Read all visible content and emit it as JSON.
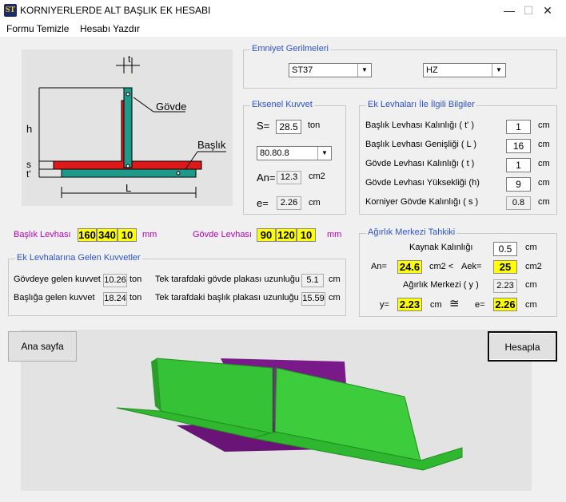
{
  "window": {
    "title": "KORNIYERLERDE ALT BAŞLIK EK HESABI",
    "icon_text": "ST",
    "min": "—",
    "max": "☐",
    "close": "✕"
  },
  "menu": {
    "item1": "Formu Temizle",
    "item2": "Hesabı Yazdır"
  },
  "sketch": {
    "t": "t",
    "h": "h",
    "s": "s",
    "t_prime": "t'",
    "L": "L",
    "govde": "Gövde",
    "baslik": "Başlık"
  },
  "emniyet": {
    "title": "Emniyet Gerilmeleri",
    "material": "ST37",
    "load_case": "HZ"
  },
  "eksenel": {
    "title": "Eksenel Kuvvet",
    "s_label": "S=",
    "s_value": "28.5",
    "s_unit": "ton",
    "section": "80.80.8",
    "an_label": "An=",
    "an_value": "12.3",
    "an_unit": "cm2",
    "e_label": "e=",
    "e_value": "2.26",
    "e_unit": "cm"
  },
  "ek": {
    "title": "Ek Levhaları İle İlgili Bilgiler",
    "rows": [
      {
        "label": "Başlık Levhası Kalınlığı ( t' )",
        "value": "1",
        "unit": "cm"
      },
      {
        "label": "Başlık Levhası Genişliği ( L )",
        "value": "16",
        "unit": "cm"
      },
      {
        "label": "Gövde Levhası Kalınlığı ( t )",
        "value": "1",
        "unit": "cm"
      },
      {
        "label": "Gövde Levhası Yüksekliği (h)",
        "value": "9",
        "unit": "cm"
      },
      {
        "label": "Korniyer Gövde Kalınlığı ( s )",
        "value": "0.8",
        "unit": "cm"
      }
    ]
  },
  "baslik_levhasi": {
    "label": "Başlık Levhası",
    "v1": "160",
    "v2": "340",
    "v3": "10",
    "unit": "mm"
  },
  "govde_levhasi": {
    "label": "Gövde Levhası",
    "v1": "90",
    "v2": "120",
    "v3": "10",
    "unit": "mm"
  },
  "kuvvet": {
    "title": "Ek Levhalarına Gelen Kuvvetler",
    "govde_label": "Gövdeye gelen kuvvet",
    "govde_value": "10.26",
    "govde_unit": "ton",
    "baslik_label": "Başlığa gelen kuvvet",
    "baslik_value": "18.24",
    "baslik_unit": "ton",
    "tek_govde_label": "Tek tarafdaki gövde plakası uzunluğu",
    "tek_govde_value": "5.1",
    "tek_govde_unit": "cm",
    "tek_baslik_label": "Tek tarafdaki başlık plakası uzunluğu",
    "tek_baslik_value": "15.59",
    "tek_baslik_unit": "cm"
  },
  "agirlik": {
    "title": "Ağırlık Merkezi Tahkiki",
    "kaynak_label": "Kaynak Kalınlığı",
    "kaynak_value": "0.5",
    "kaynak_unit": "cm",
    "an_label": "An=",
    "an_value": "24.6",
    "cm2_lt": "cm2 <",
    "aek_label": "Aek=",
    "aek_value": "25",
    "aek_unit": "cm2",
    "merkez_label": "Ağırlık Merkezi  ( y )",
    "merkez_value": "2.23",
    "merkez_unit": "cm",
    "y_label": "y=",
    "y_value": "2.23",
    "y_unit": "cm",
    "approx": "≅",
    "e_label": "e=",
    "e_value": "2.26",
    "e_unit": "cm"
  },
  "buttons": {
    "ana": "Ana sayfa",
    "hesapla": "Hesapla"
  },
  "colors": {
    "accent_blue": "#2c54c8",
    "label_magenta": "#b800b8",
    "highlight_yellow": "#ffff00",
    "angle_green": "#2fb82f",
    "plate_purple": "#7a1a8a",
    "plate_red": "#e01818",
    "plate_teal": "#1e9a8a"
  }
}
